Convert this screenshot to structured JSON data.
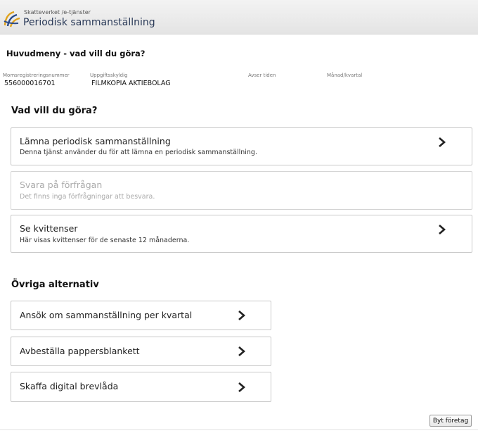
{
  "header": {
    "org_breadcrumb": "Skatteverket /e-tjänster",
    "app_title": "Periodisk sammanställning",
    "logo_icon": "skatteverket-logo-icon"
  },
  "page_heading": "Huvudmeny - vad vill du göra?",
  "info": {
    "vat_label": "Momsregistreringsnummer",
    "vat_value": "556000016701",
    "filer_label": "Uppgiftsskyldig",
    "filer_value": "FILMKOPIA AKTIEBOLAG",
    "period_label": "Avser tiden",
    "month_label": "Månad/kvartal"
  },
  "main_section": {
    "title": "Vad vill du göra?",
    "options": [
      {
        "title": "Lämna periodisk sammanställning",
        "desc": "Denna tjänst använder du för att lämna en periodisk sammanställning.",
        "enabled": true
      },
      {
        "title": "Svara på förfrågan",
        "desc": "Det finns inga förfrågningar att besvara.",
        "enabled": false
      },
      {
        "title": "Se kvittenser",
        "desc": "Här visas kvittenser för de senaste 12 månaderna.",
        "enabled": true
      }
    ]
  },
  "other_section": {
    "title": "Övriga alternativ",
    "options": [
      {
        "title": "Ansök om sammanställning per kvartal"
      },
      {
        "title": "Avbeställa pappersblankett"
      },
      {
        "title": "Skaffa digital brevlåda"
      }
    ]
  },
  "footer": {
    "change_company_label": "Byt företag"
  },
  "colors": {
    "title_blue": "#2a3a58",
    "border": "#c9c9c9",
    "disabled_text": "#aaaaaa"
  }
}
